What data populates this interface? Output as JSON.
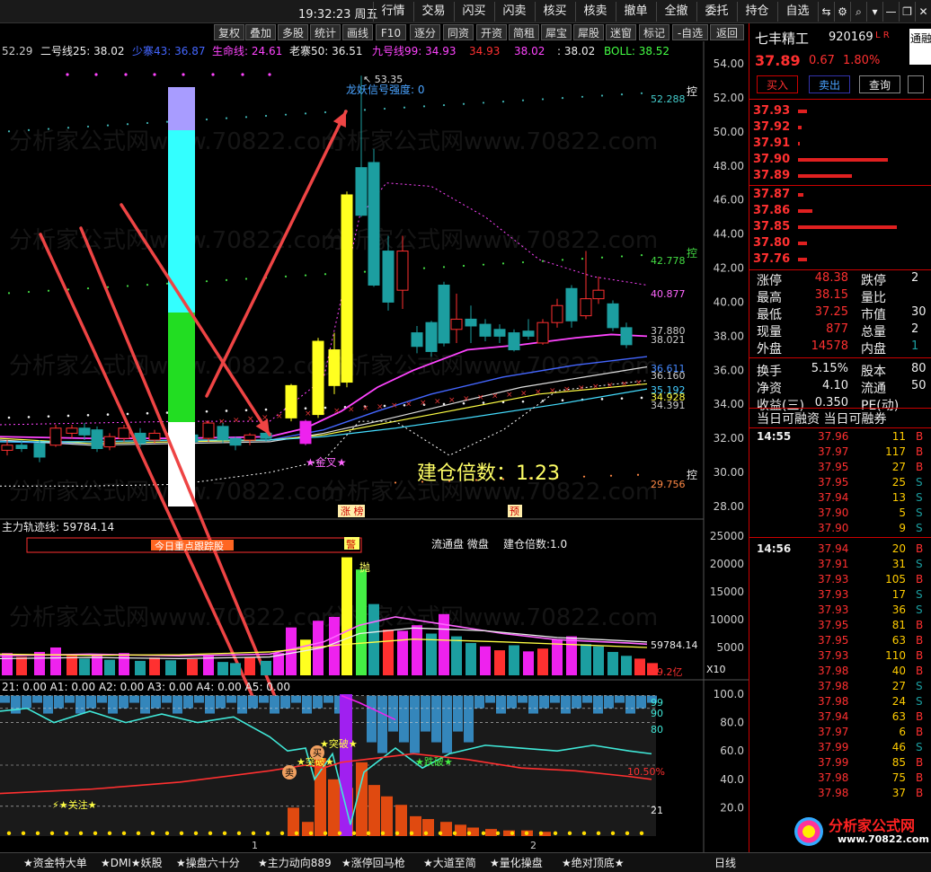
{
  "topbar": {
    "time": "19:32:23 周五",
    "buttons": [
      "行情",
      "交易",
      "闪买",
      "闪卖",
      "核买",
      "核卖",
      "撤单",
      "全撤",
      "委托",
      "持仓",
      "自选"
    ],
    "icons": [
      "swap-icon",
      "gear-icon",
      "search-icon",
      "chevron-down-icon",
      "minimize-icon",
      "restore-icon",
      "close-icon"
    ]
  },
  "menubar": {
    "items": [
      "复权",
      "叠加",
      "多股",
      "统计",
      "画线",
      "F10",
      "逐分",
      "同资",
      "开资",
      "简租",
      "犀宝",
      "犀股",
      "迷窗",
      "标记",
      "-自选",
      "返回"
    ]
  },
  "indicators": {
    "line1": "52.29",
    "ma25": "二号线25: 38.02",
    "ma43": "少寨43: 36.87",
    "life": "生命线: 24.61",
    "ma50": "老寨50: 36.51",
    "ma99": "九号线99: 34.93",
    "v1": "34.93",
    "v2": "38.02",
    "v3": ": 38.02",
    "boll": "BOLL: 38.52"
  },
  "price_axis": [
    "54.00",
    "52.00",
    "50.00",
    "48.00",
    "46.00",
    "44.00",
    "42.00",
    "40.00",
    "38.00",
    "36.00",
    "34.00",
    "32.00",
    "30.00",
    "28.00"
  ],
  "annotations": {
    "peak": "53.35",
    "signal": "龙妖信号强度: 0",
    "gold_cross": "★金叉★",
    "build_ratio": "建仓倍数：1.23",
    "zhang": "涨",
    "bang": "榜",
    "yu": "预",
    "r1": "52.288",
    "r2": "42.778",
    "r3": "40.877",
    "r4": "37.880",
    "r5": "38.021",
    "r6": "36.611",
    "r7": "36.160",
    "r8": "35.192",
    "r9": "34.928",
    "r10": "34.391",
    "r11": "29.756",
    "kong": "控"
  },
  "volume_panel": {
    "title": "主力轨迹线: 59784.14",
    "banner": "今日重点跟踪股",
    "circ": "流通盘 微盘",
    "ratio": "建仓倍数:1.0",
    "axis": [
      "25000",
      "20000",
      "15000",
      "10000",
      "5000"
    ],
    "val1": "59784.14",
    "val2": "19.2亿",
    "x10": "X10",
    "jing": "警",
    "pao": "抛"
  },
  "osc_panel": {
    "header": "21: 0.00  A1: 0.00  A2: 0.00  A3: 0.00  A4: 0.00  A5: 0.00",
    "axis": [
      "100.0",
      "80.0",
      "60.0",
      "40.0",
      "20.0"
    ],
    "right_vals": [
      "99",
      "90",
      "80",
      "21"
    ],
    "pct": "10.50%",
    "breakout1": "★突破★",
    "breakout2": "★突破★",
    "buy": "买",
    "sell": "卖",
    "dip": "★跌破★",
    "focus": "★关注★",
    "tick1": "1",
    "tick2": "2"
  },
  "stock": {
    "name": "七丰精工",
    "code": "920169",
    "suffix": "L R",
    "price": "37.89",
    "change": "0.67",
    "pct": "1.80%",
    "extra": "通融",
    "buy_btn": "买入",
    "sell_btn": "卖出",
    "query_btn": "查询"
  },
  "asks": [
    {
      "price": "37.93",
      "len": 10
    },
    {
      "price": "37.92",
      "len": 4
    },
    {
      "price": "37.91",
      "len": 2
    },
    {
      "price": "37.90",
      "len": 100
    },
    {
      "price": "37.89",
      "len": 60
    }
  ],
  "bids": [
    {
      "price": "37.87",
      "len": 6
    },
    {
      "price": "37.86",
      "len": 16
    },
    {
      "price": "37.85",
      "len": 110
    },
    {
      "price": "37.80",
      "len": 10
    },
    {
      "price": "37.76",
      "len": 10
    }
  ],
  "stats": [
    [
      "涨停",
      "48.38",
      "跌停",
      "2"
    ],
    [
      "最高",
      "38.15",
      "量比",
      ""
    ],
    [
      "最低",
      "37.25",
      "市值",
      "30"
    ],
    [
      "现量",
      "877",
      "总量",
      "2"
    ],
    [
      "外盘",
      "14578",
      "内盘",
      "1"
    ],
    [
      "换手",
      "5.15%",
      "股本",
      "80"
    ],
    [
      "净资",
      "4.10",
      "流通",
      "50"
    ],
    [
      "收益(三)",
      "0.350",
      "PE(动)",
      ""
    ]
  ],
  "margin": "当日可融资 当日可融券",
  "ticks1_time": "14:55",
  "ticks1": [
    [
      "37.96",
      "11",
      "B"
    ],
    [
      "37.97",
      "117",
      "B"
    ],
    [
      "37.95",
      "27",
      "B"
    ],
    [
      "37.95",
      "25",
      "S"
    ],
    [
      "37.94",
      "13",
      "S"
    ],
    [
      "37.90",
      "5",
      "S"
    ],
    [
      "37.90",
      "9",
      "S"
    ]
  ],
  "ticks2_time": "14:56",
  "ticks2": [
    [
      "37.94",
      "20",
      "B"
    ],
    [
      "37.91",
      "31",
      "S"
    ],
    [
      "37.93",
      "105",
      "B"
    ],
    [
      "37.93",
      "17",
      "S"
    ],
    [
      "37.93",
      "36",
      "S"
    ],
    [
      "37.95",
      "81",
      "B"
    ],
    [
      "37.95",
      "63",
      "B"
    ],
    [
      "37.93",
      "110",
      "B"
    ],
    [
      "37.98",
      "40",
      "B"
    ],
    [
      "37.98",
      "27",
      "S"
    ],
    [
      "37.98",
      "24",
      "S"
    ],
    [
      "37.94",
      "63",
      "B"
    ],
    [
      "37.97",
      "6",
      "B"
    ],
    [
      "37.99",
      "46",
      "S"
    ],
    [
      "37.99",
      "85",
      "B"
    ],
    [
      "37.98",
      "75",
      "B"
    ],
    [
      "37.98",
      "37",
      "B"
    ]
  ],
  "bottom_tabs": [
    "★资金特大单",
    "★DMI★妖股",
    "★操盘六十分",
    "★主力动向889",
    "★涨停回马枪",
    "★大道至简",
    "★量化操盘",
    "★绝对顶底★"
  ],
  "bottom_right": "日线",
  "watermark": "分析家公式网",
  "watermark_url": "www.70822.com",
  "colors": {
    "up": "#ff3030",
    "down": "#1c9ea0",
    "accent": "#e02020",
    "yellow": "#ffff00"
  }
}
